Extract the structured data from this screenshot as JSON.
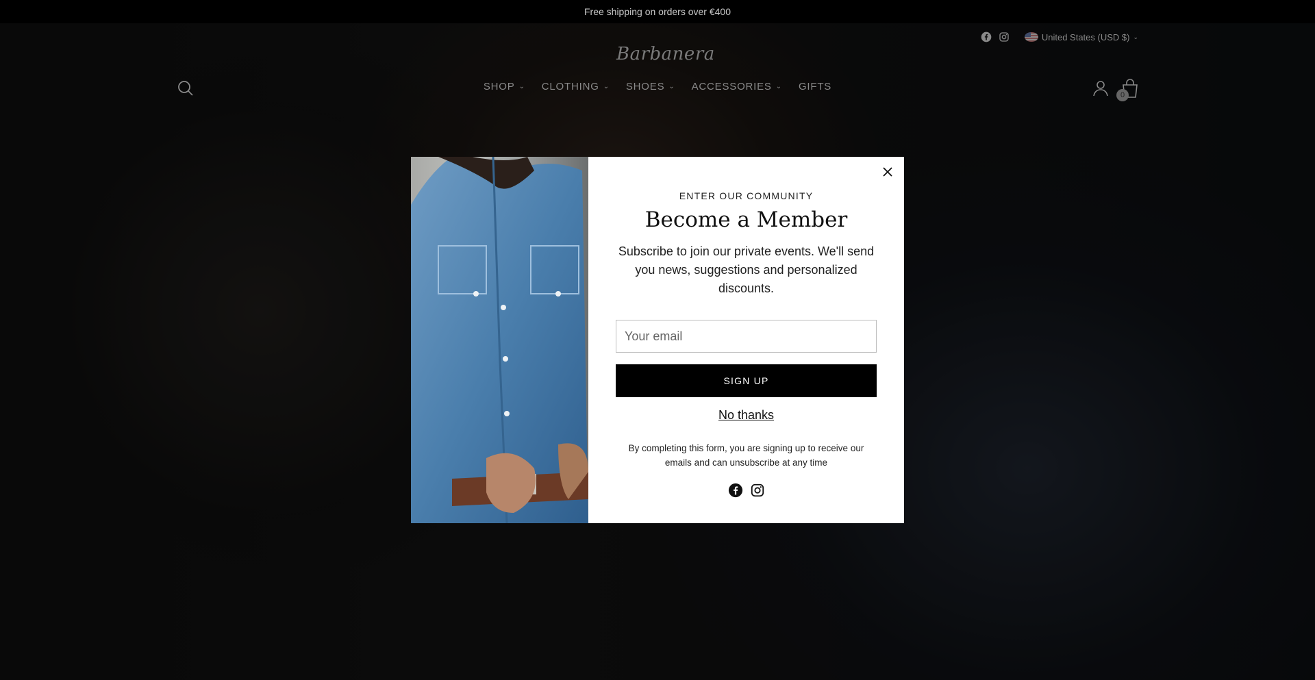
{
  "announcement": "Free shipping on orders over €400",
  "header": {
    "logo": "Barbanera",
    "country_selector": "United States (USD $)",
    "nav": [
      {
        "label": "SHOP",
        "dropdown": true
      },
      {
        "label": "CLOTHING",
        "dropdown": true
      },
      {
        "label": "SHOES",
        "dropdown": true
      },
      {
        "label": "ACCESSORIES",
        "dropdown": true
      },
      {
        "label": "GIFTS",
        "dropdown": false
      }
    ],
    "cart_count": "0",
    "icons": [
      "search-icon",
      "facebook-icon",
      "instagram-icon",
      "account-icon",
      "cart-icon",
      "chevron-down-icon"
    ]
  },
  "popup": {
    "eyebrow": "ENTER OUR COMMUNITY",
    "title": "Become a Member",
    "description": "Subscribe to join our private events. We'll send you news, suggestions and personalized discounts.",
    "email_placeholder": "Your email",
    "email_value": "",
    "signup_label": "SIGN UP",
    "no_thanks_label": "No thanks",
    "fine_print": "By completing this form, you are signing up to receive our emails and can unsubscribe at any time",
    "icons": [
      "close-icon",
      "facebook-icon",
      "instagram-icon"
    ]
  },
  "colors": {
    "announcement_bg": "#000000",
    "button_bg": "#000000",
    "modal_bg": "#ffffff"
  }
}
